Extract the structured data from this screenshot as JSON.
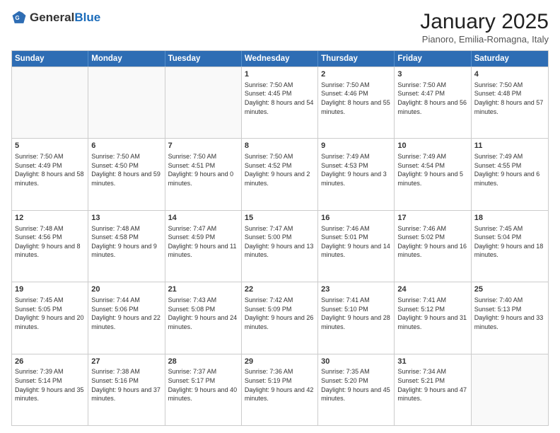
{
  "logo": {
    "general": "General",
    "blue": "Blue"
  },
  "title": "January 2025",
  "subtitle": "Pianoro, Emilia-Romagna, Italy",
  "days": [
    "Sunday",
    "Monday",
    "Tuesday",
    "Wednesday",
    "Thursday",
    "Friday",
    "Saturday"
  ],
  "weeks": [
    [
      {
        "day": "",
        "sunrise": "",
        "sunset": "",
        "daylight": ""
      },
      {
        "day": "",
        "sunrise": "",
        "sunset": "",
        "daylight": ""
      },
      {
        "day": "",
        "sunrise": "",
        "sunset": "",
        "daylight": ""
      },
      {
        "day": "1",
        "sunrise": "Sunrise: 7:50 AM",
        "sunset": "Sunset: 4:45 PM",
        "daylight": "Daylight: 8 hours and 54 minutes."
      },
      {
        "day": "2",
        "sunrise": "Sunrise: 7:50 AM",
        "sunset": "Sunset: 4:46 PM",
        "daylight": "Daylight: 8 hours and 55 minutes."
      },
      {
        "day": "3",
        "sunrise": "Sunrise: 7:50 AM",
        "sunset": "Sunset: 4:47 PM",
        "daylight": "Daylight: 8 hours and 56 minutes."
      },
      {
        "day": "4",
        "sunrise": "Sunrise: 7:50 AM",
        "sunset": "Sunset: 4:48 PM",
        "daylight": "Daylight: 8 hours and 57 minutes."
      }
    ],
    [
      {
        "day": "5",
        "sunrise": "Sunrise: 7:50 AM",
        "sunset": "Sunset: 4:49 PM",
        "daylight": "Daylight: 8 hours and 58 minutes."
      },
      {
        "day": "6",
        "sunrise": "Sunrise: 7:50 AM",
        "sunset": "Sunset: 4:50 PM",
        "daylight": "Daylight: 8 hours and 59 minutes."
      },
      {
        "day": "7",
        "sunrise": "Sunrise: 7:50 AM",
        "sunset": "Sunset: 4:51 PM",
        "daylight": "Daylight: 9 hours and 0 minutes."
      },
      {
        "day": "8",
        "sunrise": "Sunrise: 7:50 AM",
        "sunset": "Sunset: 4:52 PM",
        "daylight": "Daylight: 9 hours and 2 minutes."
      },
      {
        "day": "9",
        "sunrise": "Sunrise: 7:49 AM",
        "sunset": "Sunset: 4:53 PM",
        "daylight": "Daylight: 9 hours and 3 minutes."
      },
      {
        "day": "10",
        "sunrise": "Sunrise: 7:49 AM",
        "sunset": "Sunset: 4:54 PM",
        "daylight": "Daylight: 9 hours and 5 minutes."
      },
      {
        "day": "11",
        "sunrise": "Sunrise: 7:49 AM",
        "sunset": "Sunset: 4:55 PM",
        "daylight": "Daylight: 9 hours and 6 minutes."
      }
    ],
    [
      {
        "day": "12",
        "sunrise": "Sunrise: 7:48 AM",
        "sunset": "Sunset: 4:56 PM",
        "daylight": "Daylight: 9 hours and 8 minutes."
      },
      {
        "day": "13",
        "sunrise": "Sunrise: 7:48 AM",
        "sunset": "Sunset: 4:58 PM",
        "daylight": "Daylight: 9 hours and 9 minutes."
      },
      {
        "day": "14",
        "sunrise": "Sunrise: 7:47 AM",
        "sunset": "Sunset: 4:59 PM",
        "daylight": "Daylight: 9 hours and 11 minutes."
      },
      {
        "day": "15",
        "sunrise": "Sunrise: 7:47 AM",
        "sunset": "Sunset: 5:00 PM",
        "daylight": "Daylight: 9 hours and 13 minutes."
      },
      {
        "day": "16",
        "sunrise": "Sunrise: 7:46 AM",
        "sunset": "Sunset: 5:01 PM",
        "daylight": "Daylight: 9 hours and 14 minutes."
      },
      {
        "day": "17",
        "sunrise": "Sunrise: 7:46 AM",
        "sunset": "Sunset: 5:02 PM",
        "daylight": "Daylight: 9 hours and 16 minutes."
      },
      {
        "day": "18",
        "sunrise": "Sunrise: 7:45 AM",
        "sunset": "Sunset: 5:04 PM",
        "daylight": "Daylight: 9 hours and 18 minutes."
      }
    ],
    [
      {
        "day": "19",
        "sunrise": "Sunrise: 7:45 AM",
        "sunset": "Sunset: 5:05 PM",
        "daylight": "Daylight: 9 hours and 20 minutes."
      },
      {
        "day": "20",
        "sunrise": "Sunrise: 7:44 AM",
        "sunset": "Sunset: 5:06 PM",
        "daylight": "Daylight: 9 hours and 22 minutes."
      },
      {
        "day": "21",
        "sunrise": "Sunrise: 7:43 AM",
        "sunset": "Sunset: 5:08 PM",
        "daylight": "Daylight: 9 hours and 24 minutes."
      },
      {
        "day": "22",
        "sunrise": "Sunrise: 7:42 AM",
        "sunset": "Sunset: 5:09 PM",
        "daylight": "Daylight: 9 hours and 26 minutes."
      },
      {
        "day": "23",
        "sunrise": "Sunrise: 7:41 AM",
        "sunset": "Sunset: 5:10 PM",
        "daylight": "Daylight: 9 hours and 28 minutes."
      },
      {
        "day": "24",
        "sunrise": "Sunrise: 7:41 AM",
        "sunset": "Sunset: 5:12 PM",
        "daylight": "Daylight: 9 hours and 31 minutes."
      },
      {
        "day": "25",
        "sunrise": "Sunrise: 7:40 AM",
        "sunset": "Sunset: 5:13 PM",
        "daylight": "Daylight: 9 hours and 33 minutes."
      }
    ],
    [
      {
        "day": "26",
        "sunrise": "Sunrise: 7:39 AM",
        "sunset": "Sunset: 5:14 PM",
        "daylight": "Daylight: 9 hours and 35 minutes."
      },
      {
        "day": "27",
        "sunrise": "Sunrise: 7:38 AM",
        "sunset": "Sunset: 5:16 PM",
        "daylight": "Daylight: 9 hours and 37 minutes."
      },
      {
        "day": "28",
        "sunrise": "Sunrise: 7:37 AM",
        "sunset": "Sunset: 5:17 PM",
        "daylight": "Daylight: 9 hours and 40 minutes."
      },
      {
        "day": "29",
        "sunrise": "Sunrise: 7:36 AM",
        "sunset": "Sunset: 5:19 PM",
        "daylight": "Daylight: 9 hours and 42 minutes."
      },
      {
        "day": "30",
        "sunrise": "Sunrise: 7:35 AM",
        "sunset": "Sunset: 5:20 PM",
        "daylight": "Daylight: 9 hours and 45 minutes."
      },
      {
        "day": "31",
        "sunrise": "Sunrise: 7:34 AM",
        "sunset": "Sunset: 5:21 PM",
        "daylight": "Daylight: 9 hours and 47 minutes."
      },
      {
        "day": "",
        "sunrise": "",
        "sunset": "",
        "daylight": ""
      }
    ]
  ]
}
